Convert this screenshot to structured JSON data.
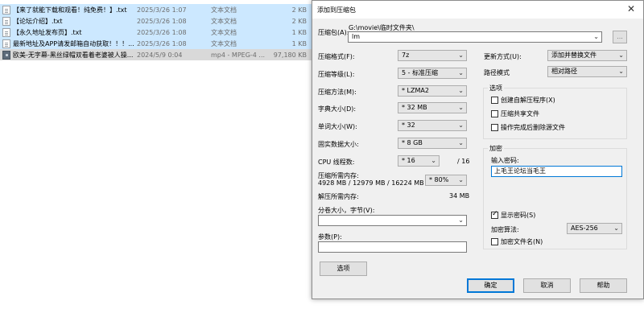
{
  "files": [
    {
      "name": "【来了就能下载和观看！纯免费！】.txt",
      "date": "2025/3/26 1:07",
      "type": "文本文档",
      "size": "2 KB"
    },
    {
      "name": "【论坛介绍】.txt",
      "date": "2025/3/26 1:08",
      "type": "文本文档",
      "size": "2 KB"
    },
    {
      "name": "【永久地址发布页】.txt",
      "date": "2025/3/26 1:08",
      "type": "文本文档",
      "size": "1 KB"
    },
    {
      "name": "最新地址及APP请发邮箱自动获取！！！...",
      "date": "2025/3/26 1:08",
      "type": "文本文档",
      "size": "1 KB"
    },
    {
      "name": "欧美-无字幕-黑丝绿帽双看着老婆被人操...",
      "date": "2024/5/9 0:04",
      "type": "mp4 - MPEG-4 ...",
      "size": "97,180 KB"
    }
  ],
  "dialog": {
    "title": "添加到压缩包",
    "close_icon": "close-icon",
    "archive_label": "压缩包(A):",
    "archive_path": "G:\\movie\\临时文件夹\\",
    "archive_name": "lm",
    "browse_label": "...",
    "format_label": "压缩格式(F):",
    "format_value": "7z",
    "level_label": "压缩等级(L):",
    "level_value": "5 - 标准压缩",
    "method_label": "压缩方法(M):",
    "method_value": "* LZMA2",
    "dict_label": "字典大小(D):",
    "dict_value": "* 32 MB",
    "word_label": "单词大小(W):",
    "word_value": "* 32",
    "solid_label": "固实数据大小:",
    "solid_value": "* 8 GB",
    "threads_label": "CPU 线程数:",
    "threads_value": "* 16",
    "threads_total": "/ 16",
    "mem_comp_label": "压缩所需内存:",
    "mem_comp_detail": "4928 MB / 12979 MB / 16224 MB",
    "mem_comp_value": "* 80%",
    "mem_decomp_label": "解压所需内存:",
    "mem_decomp_value": "34 MB",
    "split_label": "分卷大小，字节(V):",
    "split_value": "",
    "params_label": "参数(P):",
    "params_value": "",
    "options_button": "选项",
    "update_label": "更新方式(U):",
    "update_value": "添加并替换文件",
    "path_label": "路径模式",
    "path_value": "相对路径",
    "options_group": "选项",
    "opt_sfx": "创建自解压程序(X)",
    "opt_shared": "压缩共享文件",
    "opt_delete": "操作完成后删除源文件",
    "encrypt_group": "加密",
    "password_label": "输入密码:",
    "password_value": "上毛王论坛当毛王",
    "show_password": "显示密码(S)",
    "enc_method_label": "加密算法:",
    "enc_method_value": "AES-256",
    "encrypt_names": "加密文件名(N)",
    "ok": "确定",
    "cancel": "取消",
    "help": "帮助",
    "dropdown_arrow": "⌄"
  }
}
